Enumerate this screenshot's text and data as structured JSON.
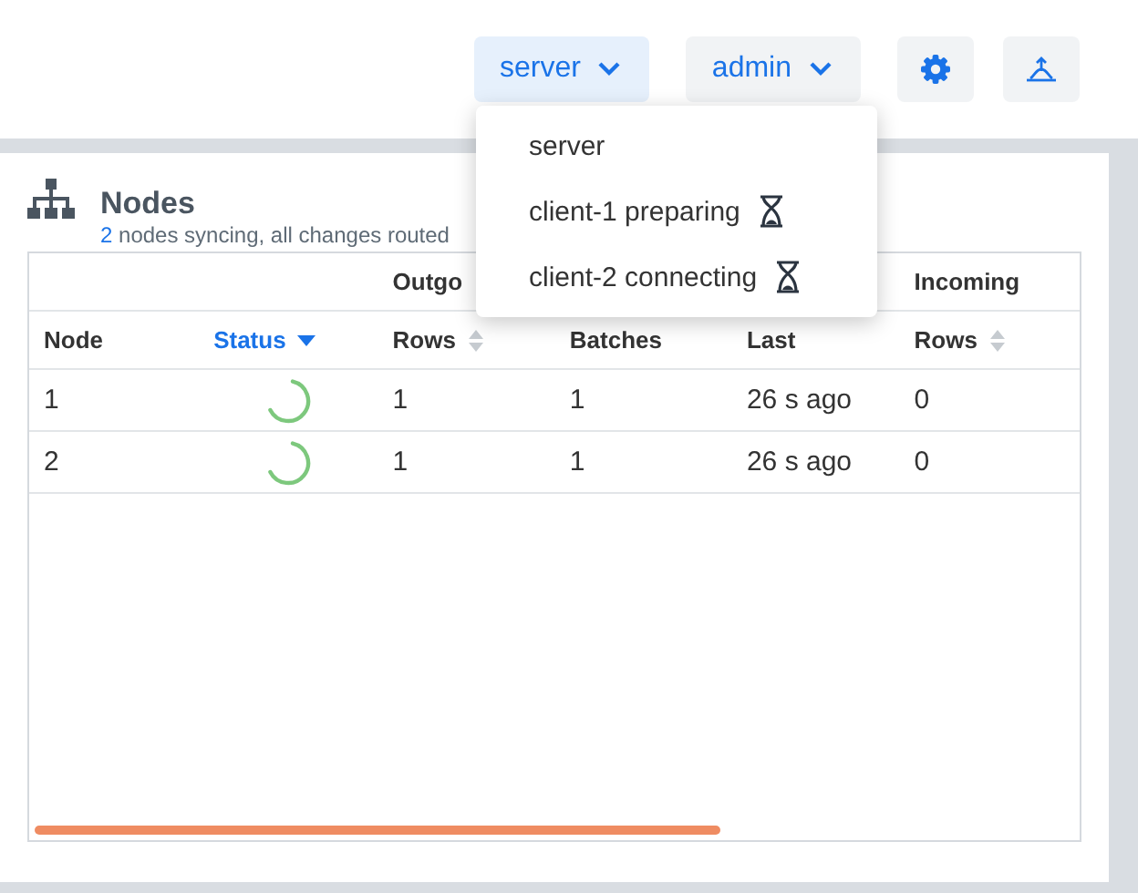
{
  "toolbar": {
    "node_menu": {
      "label": "server",
      "expanded": true
    },
    "user_menu": {
      "label": "admin"
    }
  },
  "node_dropdown": [
    {
      "label": "server",
      "pending": false
    },
    {
      "label": "client-1 preparing",
      "pending": true
    },
    {
      "label": "client-2 connecting",
      "pending": true
    }
  ],
  "panel": {
    "title": "Nodes",
    "subtitle_count": "2",
    "subtitle": " nodes syncing, all changes routed"
  },
  "table": {
    "group_1": "Outgo",
    "group_2": "Incoming",
    "columns": [
      {
        "label": "Node",
        "sorted": false,
        "sortable": false
      },
      {
        "label": "Status",
        "sorted": true,
        "sortable": true
      },
      {
        "label": "Rows",
        "sorted": false,
        "sortable": true
      },
      {
        "label": "Batches",
        "sorted": false,
        "sortable": false
      },
      {
        "label": "Last",
        "sorted": false,
        "sortable": false
      },
      {
        "label": "Rows",
        "sorted": false,
        "sortable": true
      }
    ],
    "rows": [
      {
        "node": "1",
        "syncing": true,
        "out_rows": "1",
        "batches": "1",
        "last": "26 s ago",
        "in_rows": "0"
      },
      {
        "node": "2",
        "syncing": true,
        "out_rows": "1",
        "batches": "1",
        "last": "26 s ago",
        "in_rows": "0"
      }
    ]
  }
}
